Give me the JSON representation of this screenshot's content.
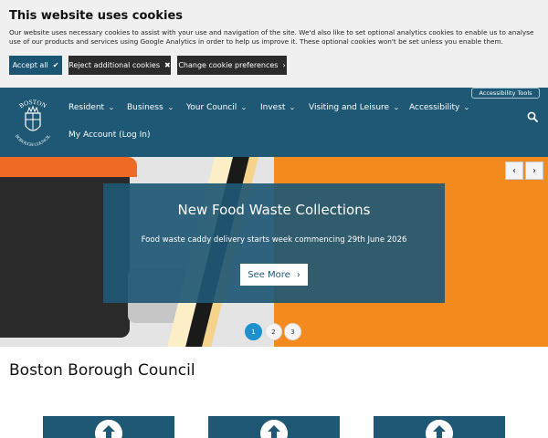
{
  "cookie": {
    "title": "This website uses cookies",
    "text": "Our website uses necessary cookies to assist with your use and navigation of the site. We'd also like to set optional analytics cookies to enable us to analyse use of our products and services using Google Analytics in order to help us improve it. These optional cookies won't be set unless you enable them.",
    "accept_label": "Accept all",
    "accept_icon": "✔",
    "reject_label": "Reject additional cookies",
    "reject_icon": "✖",
    "change_label": "Change cookie preferences",
    "change_icon": "›"
  },
  "header": {
    "logo_text_top": "BOSTON",
    "logo_text_bottom": "BOROUGH COUNCIL",
    "accessibility_tools": "Accessibility Tools",
    "nav": [
      {
        "label": "Resident"
      },
      {
        "label": "Business"
      },
      {
        "label": "Your Council"
      },
      {
        "label": "Invest"
      },
      {
        "label": "Visiting and Leisure"
      },
      {
        "label": "Accessibility"
      }
    ],
    "account": "My Account (Log In)"
  },
  "hero": {
    "title": "New Food Waste Collections",
    "subtitle": "Food waste caddy delivery starts week commencing 29th June 2026",
    "button": "See More",
    "button_icon": "›",
    "prev_icon": "‹",
    "next_icon": "›",
    "dots": [
      "1",
      "2",
      "3"
    ],
    "active_dot": 1
  },
  "page": {
    "title": "Boston Borough Council"
  },
  "colors": {
    "brand": "#1f5874",
    "orange": "#f38a1d",
    "active_dot": "#1d91cf"
  }
}
